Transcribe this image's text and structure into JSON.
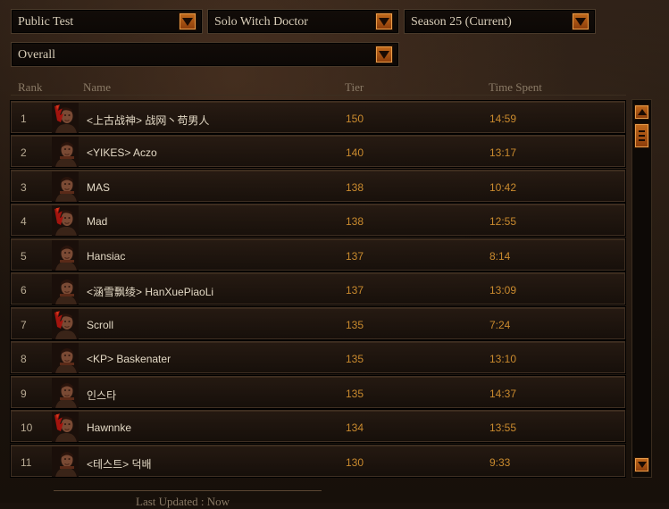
{
  "filters": {
    "mode": "Public Test",
    "category": "Solo Witch Doctor",
    "season": "Season 25 (Current)",
    "scope": "Overall"
  },
  "columns": {
    "rank": "Rank",
    "name": "Name",
    "tier": "Tier",
    "time": "Time Spent"
  },
  "rows": [
    {
      "rank": "1",
      "name": "<上古战神> 战网丶苟男人",
      "tier": "150",
      "time": "14:59",
      "portrait": "female-witch-doctor-portrait"
    },
    {
      "rank": "2",
      "name": "<YIKES> Aczo",
      "tier": "140",
      "time": "13:17",
      "portrait": "male-witch-doctor-portrait"
    },
    {
      "rank": "3",
      "name": "MAS",
      "tier": "138",
      "time": "10:42",
      "portrait": "male-witch-doctor-portrait"
    },
    {
      "rank": "4",
      "name": "Mad",
      "tier": "138",
      "time": "12:55",
      "portrait": "female-witch-doctor-portrait"
    },
    {
      "rank": "5",
      "name": "Hansiac",
      "tier": "137",
      "time": "8:14",
      "portrait": "male-witch-doctor-portrait"
    },
    {
      "rank": "6",
      "name": "<涵雪飘绫> HanXuePiaoLi",
      "tier": "137",
      "time": "13:09",
      "portrait": "male-witch-doctor-portrait"
    },
    {
      "rank": "7",
      "name": "Scroll",
      "tier": "135",
      "time": "7:24",
      "portrait": "female-witch-doctor-portrait"
    },
    {
      "rank": "8",
      "name": "<KP> Baskenater",
      "tier": "135",
      "time": "13:10",
      "portrait": "male-witch-doctor-portrait"
    },
    {
      "rank": "9",
      "name": "인스타",
      "tier": "135",
      "time": "14:37",
      "portrait": "male-witch-doctor-portrait"
    },
    {
      "rank": "10",
      "name": "Hawnnke",
      "tier": "134",
      "time": "13:55",
      "portrait": "female-witch-doctor-portrait"
    },
    {
      "rank": "11",
      "name": "<테스트> 덕배",
      "tier": "130",
      "time": "9:33",
      "portrait": "male-witch-doctor-portrait"
    }
  ],
  "footer": {
    "status": "Last Updated : Now"
  },
  "colors": {
    "accent": "#c26a1c",
    "value": "#c98a2e",
    "text": "#e2d8c4"
  }
}
